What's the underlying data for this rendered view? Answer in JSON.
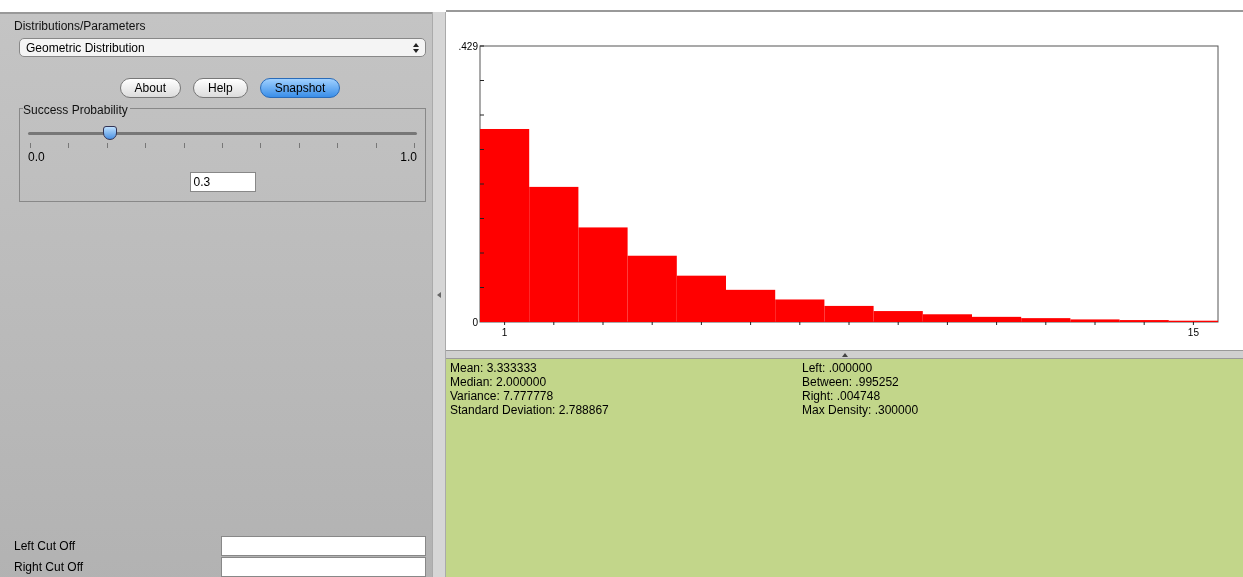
{
  "parameters_panel": {
    "title": "Distributions/Parameters",
    "distribution": "Geometric Distribution",
    "buttons": [
      {
        "label": "About",
        "selected": false
      },
      {
        "label": "Help",
        "selected": false
      },
      {
        "label": "Snapshot",
        "selected": true
      }
    ],
    "slider": {
      "title": "Success Probability",
      "level": 0.21,
      "min_label": "0.0",
      "max_label": "1.0",
      "value": "0.3"
    },
    "cutoffs": [
      {
        "label": "Left Cut Off"
      },
      {
        "label": "Right Cut Off"
      }
    ]
  },
  "chart": {
    "chart_data": {
      "type": "bar",
      "x": [
        1,
        2,
        3,
        4,
        5,
        6,
        7,
        8,
        9,
        10,
        11,
        12,
        13,
        14,
        15
      ],
      "series": [
        {
          "color": "#ff0000",
          "values": [
            0.3,
            0.21,
            0.147,
            0.103,
            0.072,
            0.05,
            0.035,
            0.025,
            0.017,
            0.012,
            0.008,
            0.006,
            0.004,
            0.003,
            0.002
          ]
        }
      ],
      "xlim": [
        0.5,
        15.5
      ],
      "ylim": [
        0,
        0.429
      ],
      "yticks": [
        {
          "value": 0,
          "label": "0"
        },
        {
          "value": 0.429,
          "label": ".429"
        }
      ],
      "xticks": [
        1,
        15
      ]
    }
  },
  "statistics": {
    "left_column": [
      "Mean: 3.333333",
      "Median: 2.000000",
      "Variance: 7.777778",
      "Standard Deviation: 2.788867"
    ],
    "right_column": [
      "Left: .000000",
      "Between: .995252",
      "Right: .004748",
      "Max Density: .300000"
    ]
  }
}
